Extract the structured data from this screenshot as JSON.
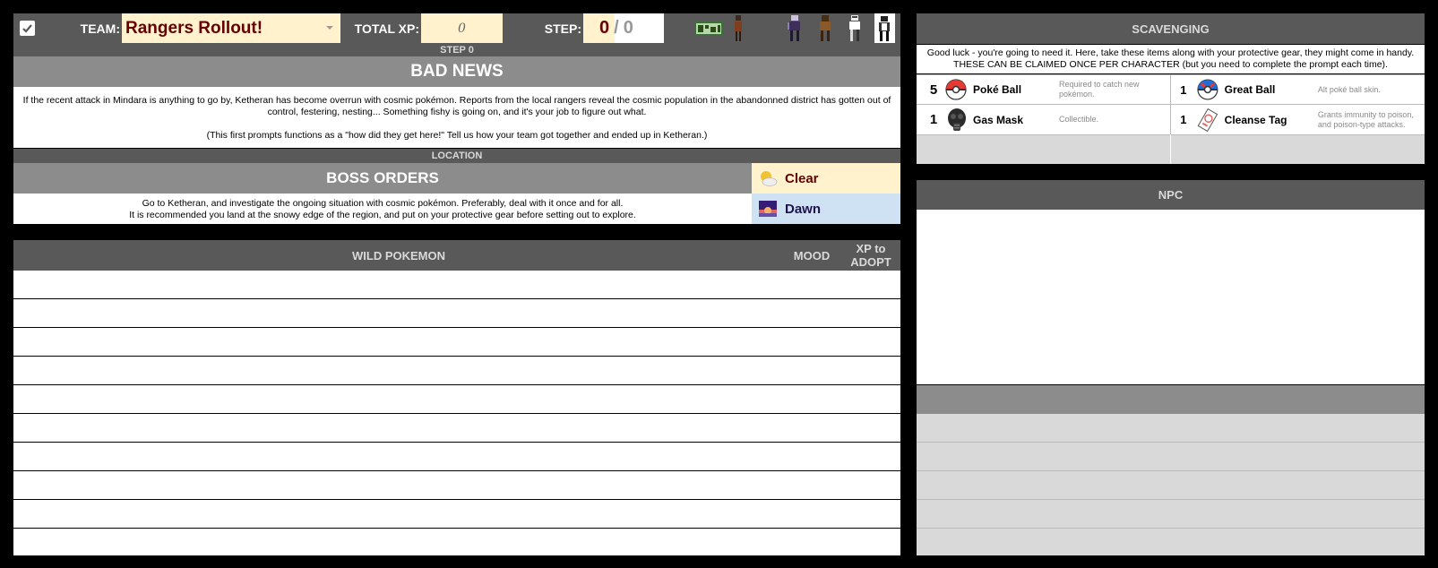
{
  "topbar": {
    "checkbox_checked": true,
    "team_label": "TEAM:",
    "team_value": "Rangers Rollout!",
    "totalxp_label": "TOTAL XP:",
    "totalxp_value": "0",
    "step_label": "STEP:",
    "step_current": "0",
    "step_separator": "/",
    "step_total": "0"
  },
  "step_band": "STEP 0",
  "story": {
    "title": "BAD NEWS",
    "paragraph1": "If the recent attack in Mindara is anything to go by, Ketheran has become overrun with cosmic pokémon. Reports from the local rangers reveal the cosmic population in the abandonned district has gotten out of control, festering, nesting... Something fishy is going on, and it's your job to figure out what.",
    "paragraph2": "(This first prompts functions as a \"how did they get here!\" Tell us how your team got together and ended up in Ketheran.)"
  },
  "location_band": "LOCATION",
  "orders": {
    "title": "BOSS ORDERS",
    "line1": "Go to Ketheran, and investigate the ongoing situation with cosmic pokémon. Preferably, deal with it once and for all.",
    "line2": "It is recommended you land at the snowy edge of the region, and put on your protective gear before setting out to explore."
  },
  "weather": {
    "condition": "Clear",
    "condition_icon": "partly-cloudy-icon",
    "time": "Dawn",
    "time_icon": "dawn-icon"
  },
  "wild": {
    "col_pokemon": "WILD POKEMON",
    "col_mood": "MOOD",
    "col_xp": "XP to ADOPT"
  },
  "scavenging": {
    "title": "SCAVENGING",
    "intro1": "Good luck - you're going to need it. Here, take these items along with your protective gear, they might come in handy.",
    "intro2": "THESE CAN BE CLAIMED ONCE PER CHARACTER (but you need to complete the prompt each time).",
    "items": [
      {
        "qty": "5",
        "name": "Poké Ball",
        "desc": "Required to catch new pokémon.",
        "icon": "poke-ball-icon"
      },
      {
        "qty": "1",
        "name": "Great Ball",
        "desc": "Alt poké ball skin.",
        "icon": "great-ball-icon"
      },
      {
        "qty": "1",
        "name": "Gas Mask",
        "desc": "Collectible.",
        "icon": "gas-mask-icon"
      },
      {
        "qty": "1",
        "name": "Cleanse Tag",
        "desc": "Grants immunity to poison, and poison-type attacks.",
        "icon": "cleanse-tag-icon"
      }
    ]
  },
  "npc": {
    "title": "NPC"
  },
  "colors": {
    "header_dark": "#595959",
    "header_mid": "#8c8c8c",
    "cream": "#fff2cc",
    "light_blue": "#cfe2f3",
    "team_text": "#660000",
    "dawn_text": "#20124d"
  }
}
